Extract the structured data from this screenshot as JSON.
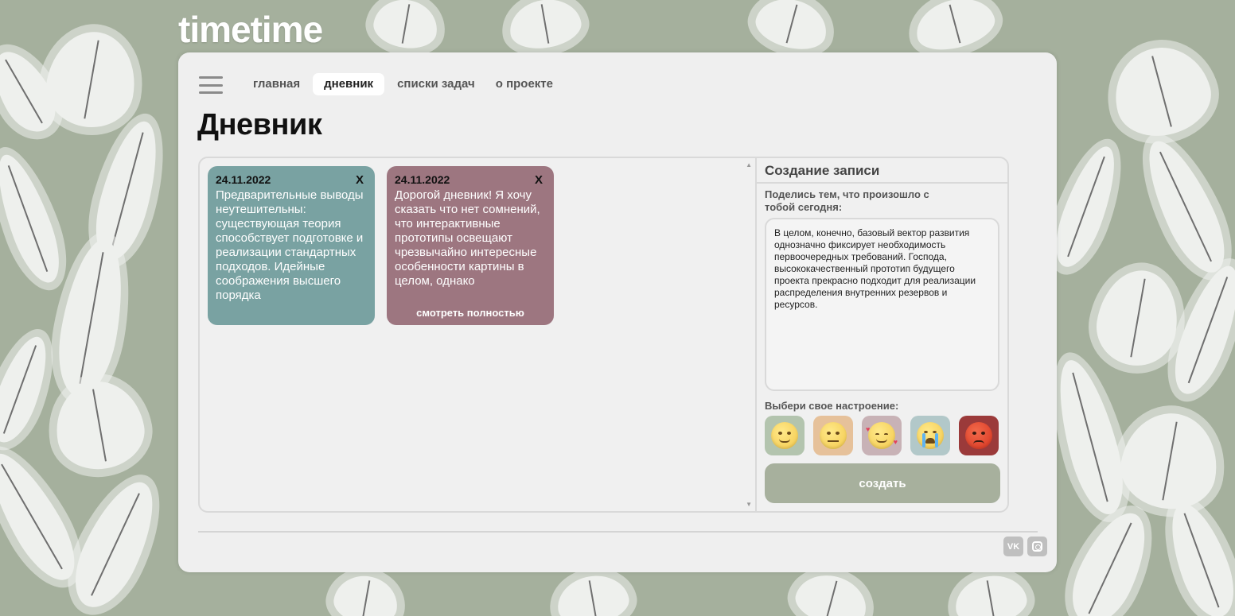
{
  "app": {
    "logo": "timetime"
  },
  "nav": {
    "items": [
      {
        "label": "главная",
        "active": false
      },
      {
        "label": "дневник",
        "active": true
      },
      {
        "label": "списки задач",
        "active": false
      },
      {
        "label": "о проекте",
        "active": false
      }
    ]
  },
  "page": {
    "title": "Дневник"
  },
  "notes": [
    {
      "date": "24.11.2022",
      "close": "X",
      "text": "Предварительные выводы неутешительны: существующая теория способствует подготовке и реализации стандартных подходов. Идейные соображения высшего порядка",
      "color": "#79a2a2"
    },
    {
      "date": "24.11.2022",
      "close": "X",
      "text": "Дорогой дневник! Я хочу сказать что нет сомнений, что интерактивные прототипы освещают чрезвычайно интересные особенности картины в целом, однако",
      "color": "#9d7680",
      "see_full": "смотреть полностью"
    }
  ],
  "create": {
    "title": "Создание записи",
    "prompt": "Поделись тем, что произошло с тобой сегодня:",
    "entry_text": "В целом, конечно, базовый вектор развития однозначно фиксирует необходимость первоочередных требований. Господа, высококачественный прототип будущего проекта прекрасно подходит для реализации распределения внутренних резервов и ресурсов.",
    "mood_label": "Выбери свое настроение:",
    "moods": [
      {
        "icon": "smiling-face-icon",
        "color": "#b3c4ae"
      },
      {
        "icon": "neutral-face-icon",
        "color": "#e6c19a"
      },
      {
        "icon": "smiling-face-with-hearts-icon",
        "color": "#c8b2b6"
      },
      {
        "icon": "crying-face-icon",
        "color": "#b2c8c9"
      },
      {
        "icon": "angry-face-icon",
        "color": "#9b3a3a"
      }
    ],
    "button_label": "создать"
  },
  "footer": {
    "social": [
      {
        "icon": "vk-icon",
        "label": "VK"
      },
      {
        "icon": "instagram-icon",
        "label": ""
      }
    ]
  }
}
